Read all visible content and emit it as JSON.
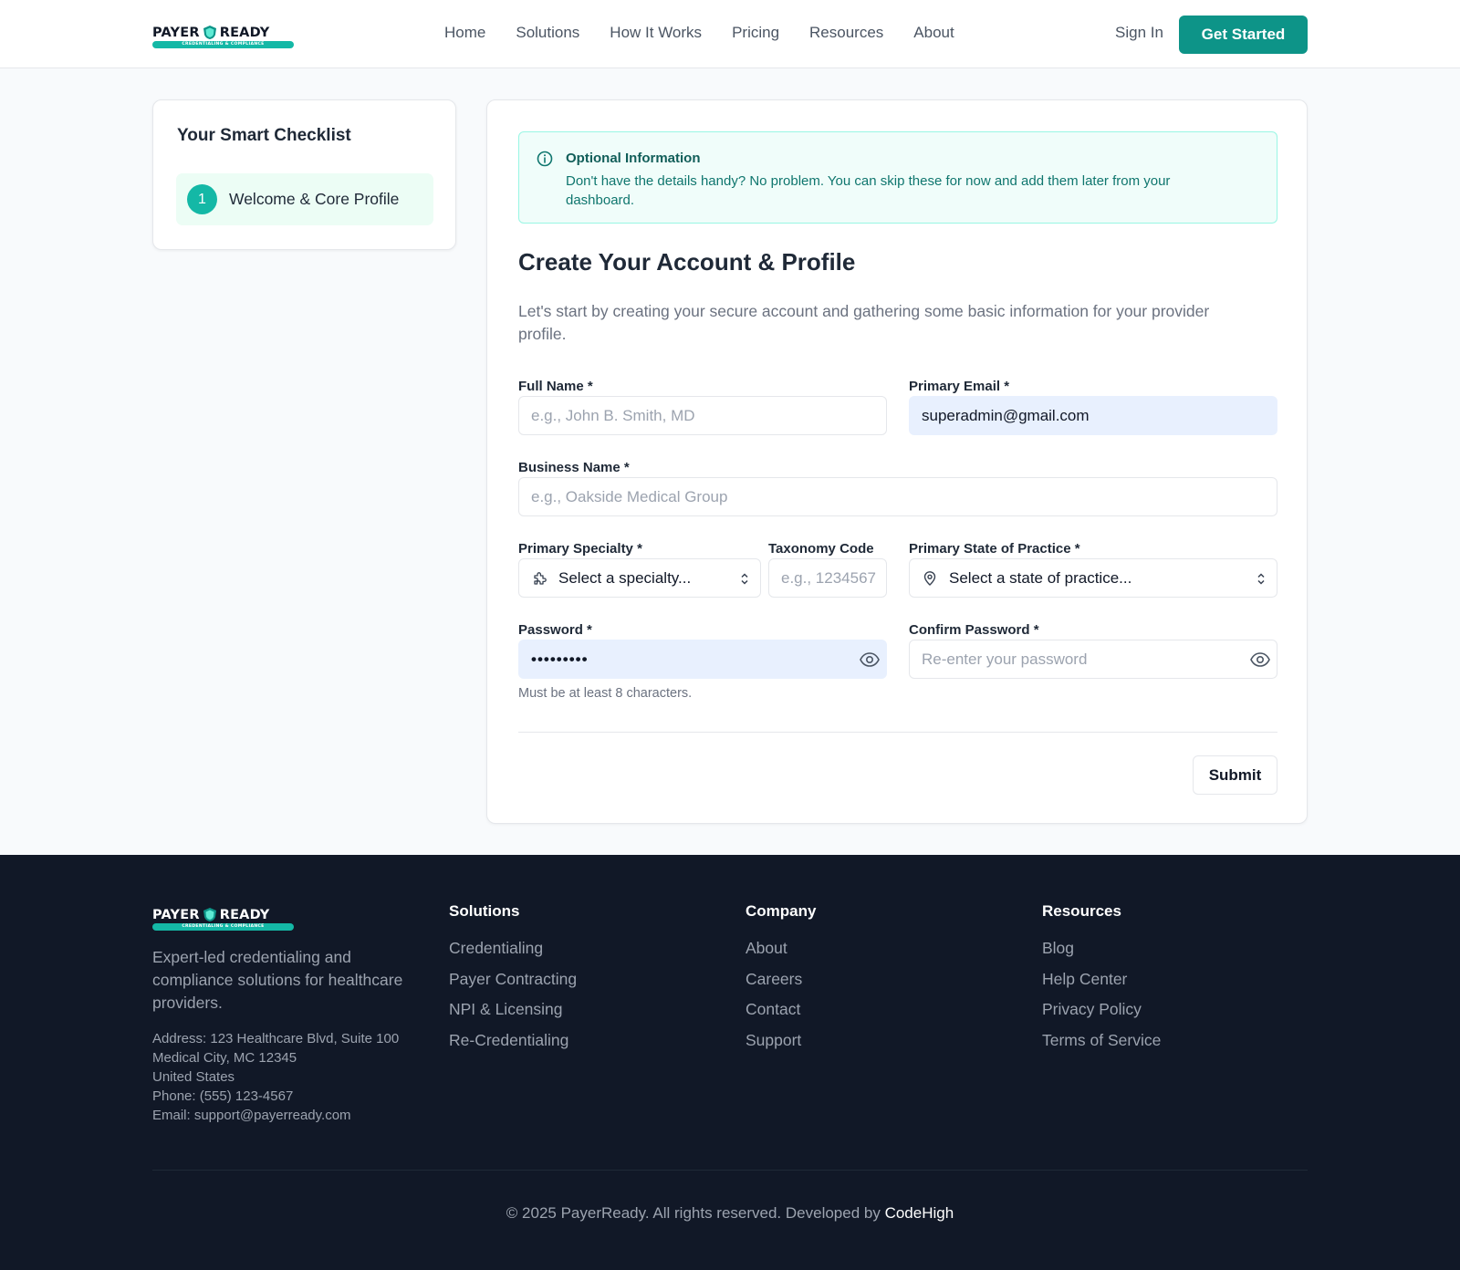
{
  "brand": {
    "name_left": "PAYER",
    "name_right": "READY",
    "tagline": "CREDENTIALING & COMPLIANCE",
    "accent_color": "#0d9488",
    "accent_light": "#14b8a6"
  },
  "header": {
    "nav": [
      "Home",
      "Solutions",
      "How It Works",
      "Pricing",
      "Resources",
      "About"
    ],
    "sign_in": "Sign In",
    "get_started": "Get Started"
  },
  "sidebar": {
    "title": "Your Smart Checklist",
    "items": [
      {
        "number": "1",
        "label": "Welcome & Core Profile",
        "active": true
      }
    ]
  },
  "form": {
    "info": {
      "icon": "info-circle-icon",
      "title": "Optional Information",
      "text": "Don't have the details handy? No problem. You can skip these for now and add them later from your dashboard."
    },
    "title": "Create Your Account & Profile",
    "description": "Let's start by creating your secure account and gathering some basic information for your provider profile.",
    "full_name": {
      "label": "Full Name *",
      "placeholder": "e.g., John B. Smith, MD",
      "value": ""
    },
    "email": {
      "label": "Primary Email *",
      "value": "superadmin@gmail.com"
    },
    "business_name": {
      "label": "Business Name *",
      "placeholder": "e.g., Oakside Medical Group",
      "value": ""
    },
    "specialty": {
      "label": "Primary Specialty *",
      "value": "Select a specialty...",
      "icon": "puzzle-icon"
    },
    "taxonomy": {
      "label": "Taxonomy Code",
      "placeholder": "e.g., 1234567"
    },
    "state": {
      "label": "Primary State of Practice *",
      "value": "Select a state of practice...",
      "icon": "map-pin-icon"
    },
    "password": {
      "label": "Password *",
      "value": "•••••••••",
      "hint": "Must be at least 8 characters."
    },
    "confirm_password": {
      "label": "Confirm Password *",
      "placeholder": "Re-enter your password"
    },
    "submit": "Submit"
  },
  "footer": {
    "tagline": "Expert-led credentialing and compliance solutions for healthcare providers.",
    "address_lines": [
      "Address: 123 Healthcare Blvd, Suite 100",
      "Medical City, MC 12345",
      "United States",
      "Phone: (555) 123-4567",
      "Email: support@payerready.com"
    ],
    "columns": [
      {
        "title": "Solutions",
        "links": [
          "Credentialing",
          "Payer Contracting",
          "NPI & Licensing",
          "Re-Credentialing"
        ]
      },
      {
        "title": "Company",
        "links": [
          "About",
          "Careers",
          "Contact",
          "Support"
        ]
      },
      {
        "title": "Resources",
        "links": [
          "Blog",
          "Help Center",
          "Privacy Policy",
          "Terms of Service"
        ]
      }
    ],
    "copyright": "© 2025 PayerReady. All rights reserved. Developed by",
    "developer": "CodeHigh"
  }
}
